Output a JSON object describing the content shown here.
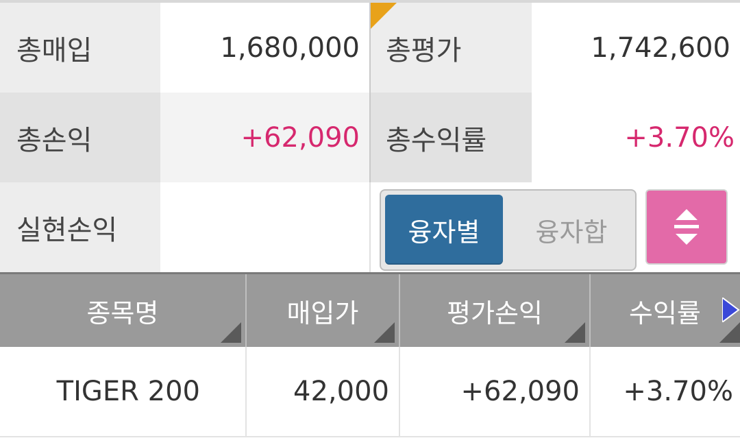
{
  "summary": {
    "total_purchase_label": "총매입",
    "total_purchase_value": "1,680,000",
    "total_eval_label": "총평가",
    "total_eval_value": "1,742,600",
    "total_pl_label": "총손익",
    "total_pl_value": "+62,090",
    "total_return_label": "총수익률",
    "total_return_value": "+3.70%",
    "realized_pl_label": "실현손익",
    "realized_pl_value": ""
  },
  "segment": {
    "by_loan_label": "융자별",
    "sum_loan_label": "융자합",
    "selected": "융자별"
  },
  "sort_button_icon": "sort-updown-icon",
  "table": {
    "headers": [
      "종목명",
      "매입가",
      "평가손익",
      "수익률"
    ],
    "rows": [
      {
        "name": "TIGER 200",
        "purchase_price": "42,000",
        "eval_pl": "+62,090",
        "return_rate": "+3.70%"
      }
    ]
  },
  "colors": {
    "positive": "#d6286e",
    "segment_active": "#2f6d9d",
    "sort_button": "#e36aa8",
    "header_bg": "#9a9a9a",
    "scroll_arrow": "#3a48d8",
    "corner_marker": "#e8a21a"
  }
}
